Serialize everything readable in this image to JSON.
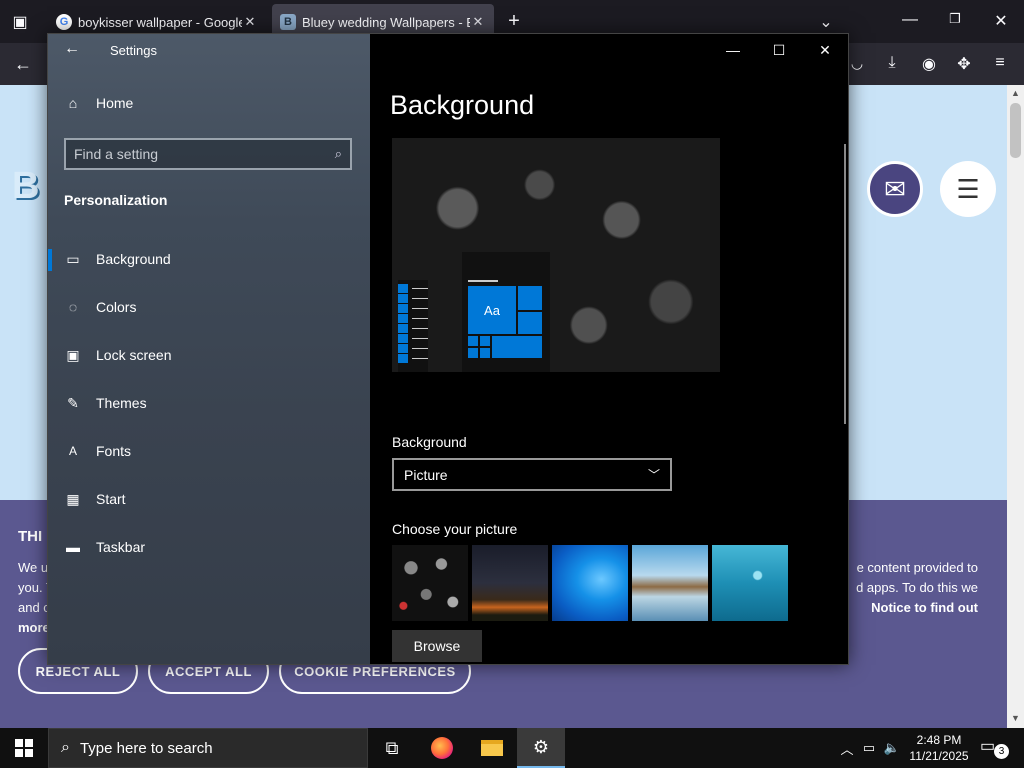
{
  "browser": {
    "tabs": [
      {
        "title": "boykisser wallpaper - Google Se",
        "favicon": "G"
      },
      {
        "title": "Bluey wedding Wallpapers - Blu",
        "favicon": "B"
      }
    ]
  },
  "webpage": {
    "logo": "B",
    "cookie": {
      "title": "THI",
      "line1_left": "We u",
      "line1_right": "e content provided to",
      "line2_left": "you. T",
      "line2_right": "d apps. To do this we",
      "line3_left": "and c",
      "line3_right": "Notice to find out",
      "line4_left": "more",
      "reject": "REJECT ALL",
      "accept": "ACCEPT ALL",
      "prefs": "COOKIE PREFERENCES"
    }
  },
  "settings": {
    "app_title": "Settings",
    "home": "Home",
    "search_placeholder": "Find a setting",
    "section": "Personalization",
    "nav": [
      {
        "label": "Background",
        "icon": "picture-icon"
      },
      {
        "label": "Colors",
        "icon": "palette-icon"
      },
      {
        "label": "Lock screen",
        "icon": "lock-screen-icon"
      },
      {
        "label": "Themes",
        "icon": "themes-icon"
      },
      {
        "label": "Fonts",
        "icon": "fonts-icon"
      },
      {
        "label": "Start",
        "icon": "start-icon"
      },
      {
        "label": "Taskbar",
        "icon": "taskbar-icon"
      }
    ],
    "page_title": "Background",
    "preview_tile": "Aa",
    "background_label": "Background",
    "background_value": "Picture",
    "choose_label": "Choose your picture",
    "browse": "Browse"
  },
  "taskbar": {
    "search_placeholder": "Type here to search",
    "time": "2:48 PM",
    "date": "11/21/2025",
    "notifications": "3"
  },
  "colors": {
    "accent": "#0078d7",
    "web_background": "#c9e3f7",
    "cookie_banner": "#5b5890"
  }
}
